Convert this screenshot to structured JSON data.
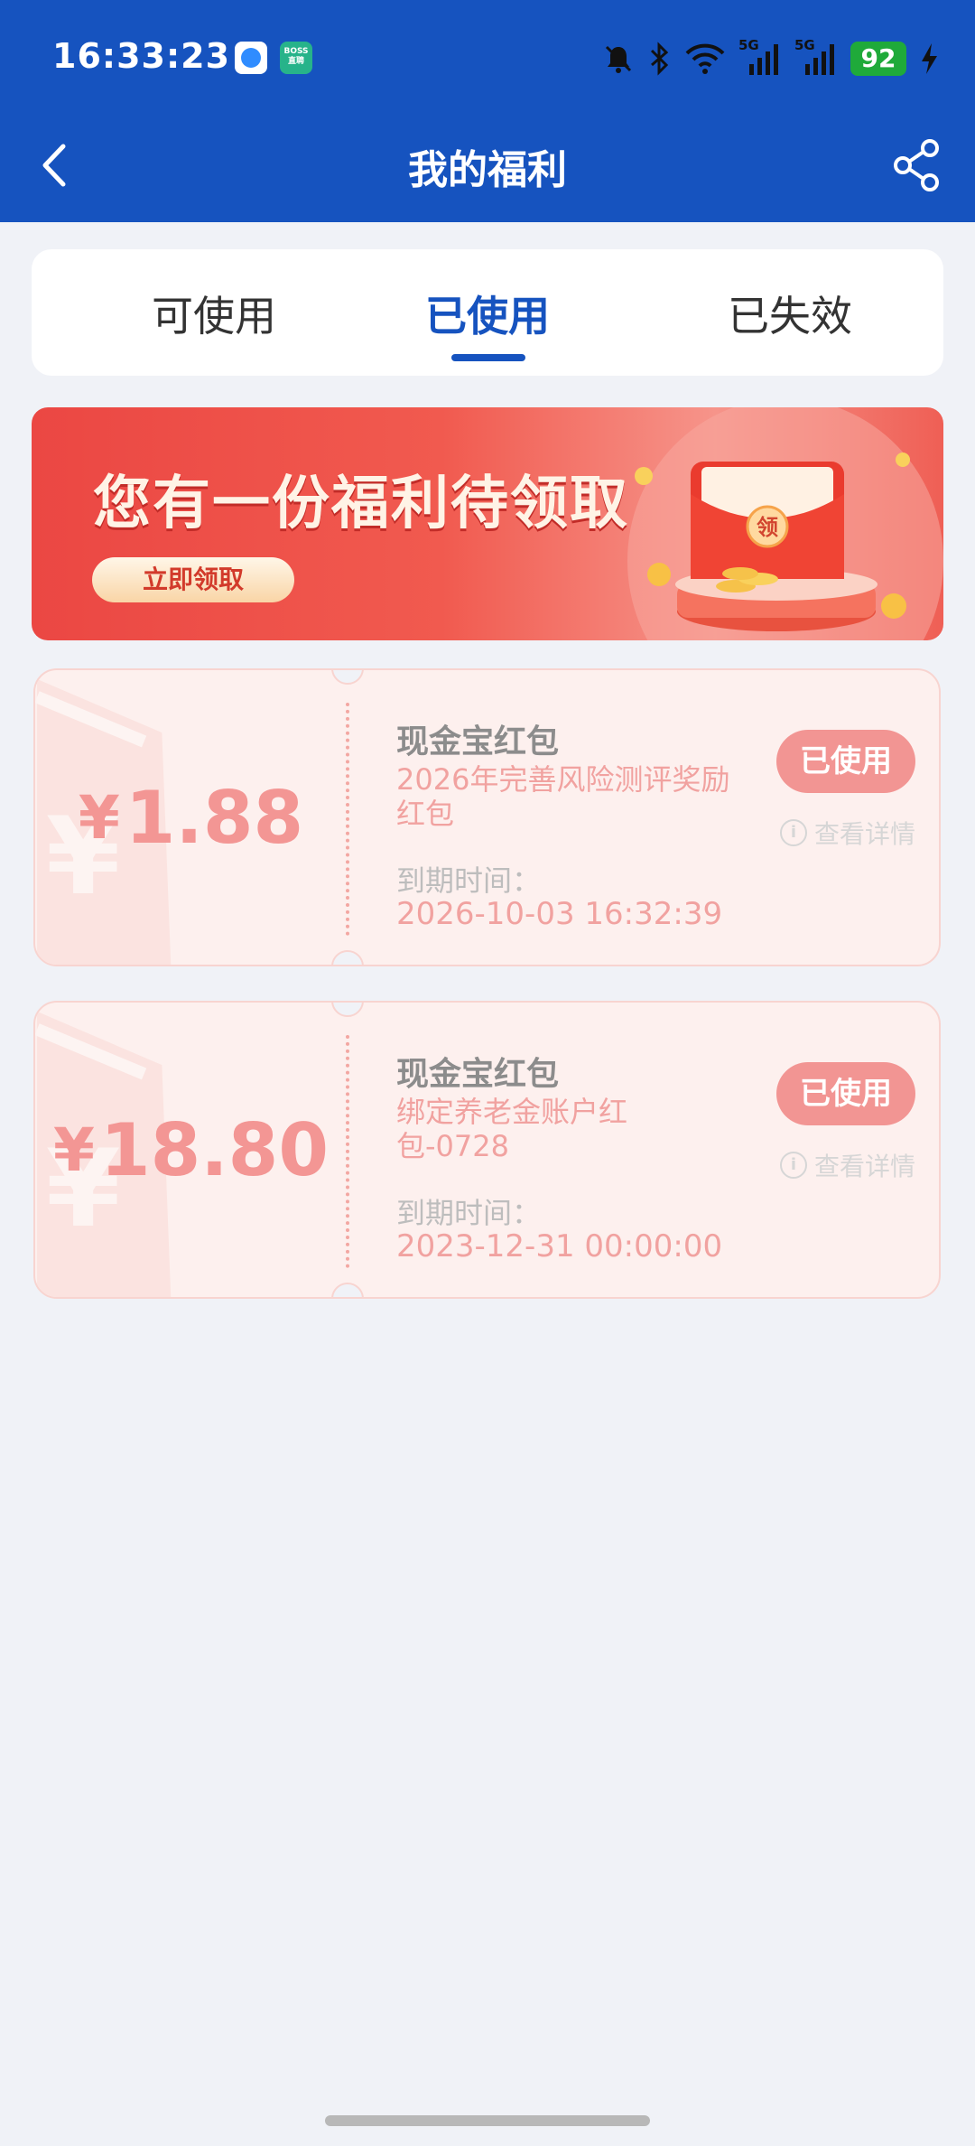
{
  "status_bar": {
    "time": "16:33:23",
    "app_icon_2_text": "BOSS直聘",
    "battery": "92",
    "signal_label_1": "5G",
    "signal_label_2": "5G"
  },
  "header": {
    "title": "我的福利",
    "bg_color": "#1653bf"
  },
  "tabs": [
    {
      "label": "可使用",
      "active": false
    },
    {
      "label": "已使用",
      "active": true
    },
    {
      "label": "已失效",
      "active": false
    }
  ],
  "banner": {
    "title": "您有一份福利待领取",
    "button": "立即领取",
    "badge": "领"
  },
  "coupons": [
    {
      "currency": "¥",
      "amount": "1.88",
      "name": "现金宝红包",
      "description": "2026年完善风险测评奖励红包",
      "expiry_label": "到期时间：",
      "expiry": "2026-10-03 16:32:39",
      "status_button": "已使用",
      "detail_link": "查看详情"
    },
    {
      "currency": "¥",
      "amount": "18.80",
      "name": "现金宝红包",
      "description": "绑定养老金账户红包-0728",
      "expiry_label": "到期时间：",
      "expiry": "2023-12-31 00:00:00",
      "status_button": "已使用",
      "detail_link": "查看详情"
    }
  ]
}
